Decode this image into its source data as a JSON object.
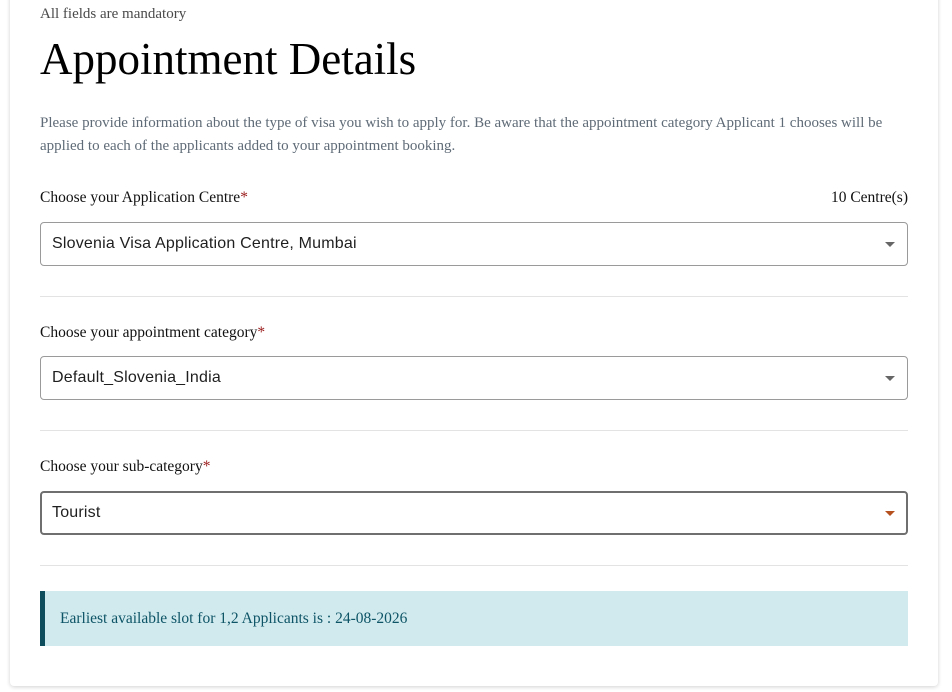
{
  "form": {
    "mandatory_note": "All fields are mandatory",
    "title": "Appointment Details",
    "description": "Please provide information about the type of visa you wish to apply for. Be aware that the appointment category Applicant 1 chooses will be applied to each of the applicants added to your appointment booking.",
    "required_marker": "*"
  },
  "application_centre": {
    "label": "Choose your Application Centre",
    "count": "10 Centre(s)",
    "value": "Slovenia Visa Application Centre, Mumbai"
  },
  "appointment_category": {
    "label": "Choose your appointment category",
    "value": "Default_Slovenia_India"
  },
  "sub_category": {
    "label": "Choose your sub-category",
    "value": "Tourist"
  },
  "alert": {
    "text": "Earliest available slot for 1,2 Applicants is : 24-08-2026"
  },
  "icons": {
    "dropdown": "caret-down-icon"
  },
  "colors": {
    "required": "#9b1c1c",
    "alert_bg": "#d1eaee",
    "alert_border": "#0d4d5c",
    "alert_text": "#0d5466",
    "focused_caret": "#b5501f"
  }
}
